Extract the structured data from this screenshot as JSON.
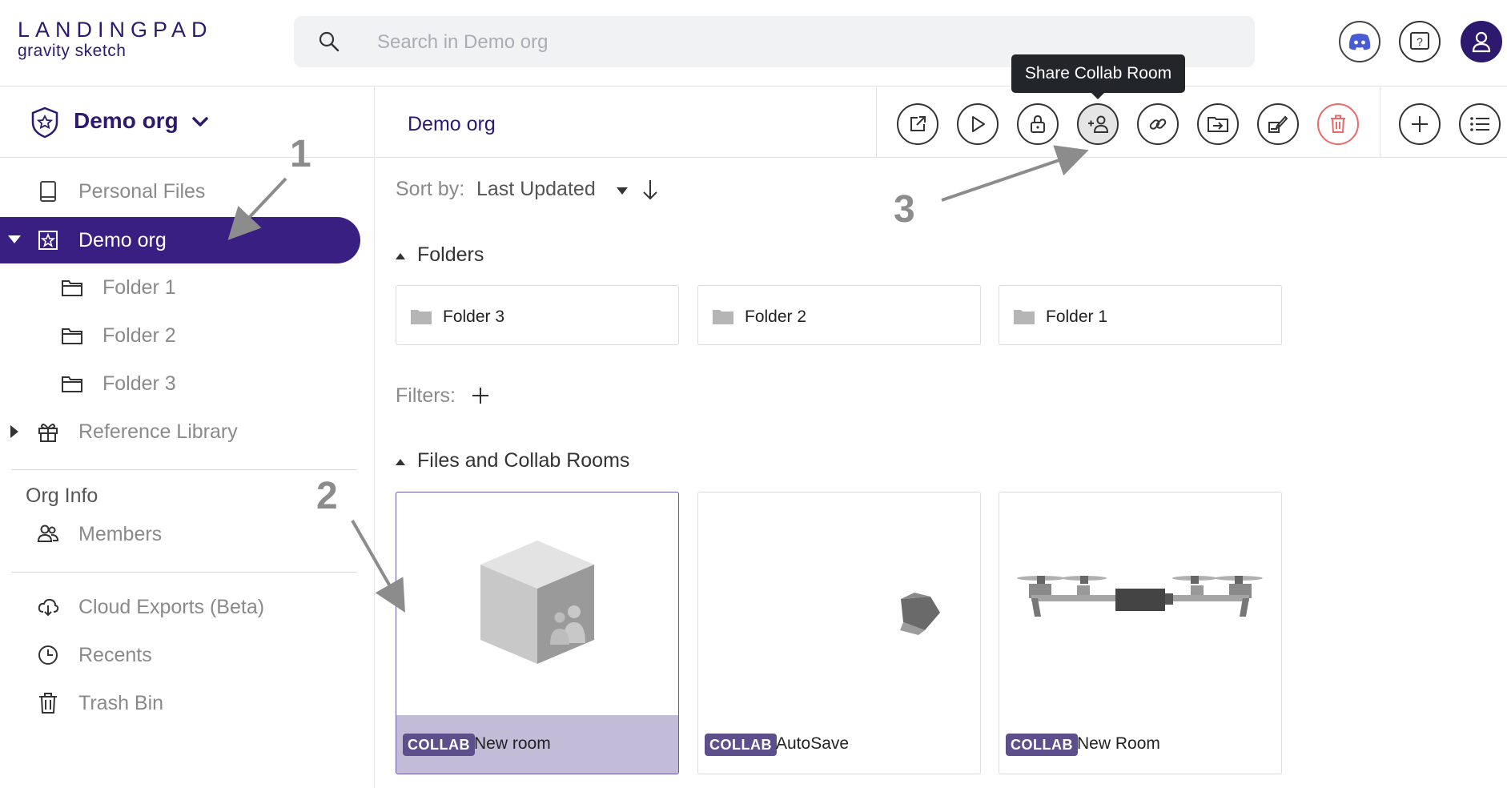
{
  "header": {
    "logo_top": "LANDINGPAD",
    "logo_bottom": "gravity sketch",
    "search_placeholder": "Search in Demo org"
  },
  "sidebar": {
    "org_name": "Demo org",
    "items": [
      {
        "label": "Personal Files",
        "icon": "tablet-icon"
      },
      {
        "label": "Demo org",
        "icon": "org-star-icon",
        "active": true
      },
      {
        "label": "Folder 1",
        "icon": "folder-icon"
      },
      {
        "label": "Folder 2",
        "icon": "folder-icon"
      },
      {
        "label": "Folder 3",
        "icon": "folder-icon"
      },
      {
        "label": "Reference Library",
        "icon": "gift-icon"
      }
    ],
    "org_info_title": "Org Info",
    "members_label": "Members",
    "bottom_items": [
      {
        "label": "Cloud Exports (Beta)",
        "icon": "cloud-download-icon"
      },
      {
        "label": "Recents",
        "icon": "clock-icon"
      },
      {
        "label": "Trash Bin",
        "icon": "trash-icon"
      }
    ]
  },
  "toolbar": {
    "breadcrumb": "Demo org",
    "tooltip": "Share Collab Room",
    "danger_color": "#e86a6a"
  },
  "content": {
    "sort_label": "Sort by:",
    "sort_value": "Last Updated",
    "folders_title": "Folders",
    "folders": [
      "Folder 3",
      "Folder 2",
      "Folder 1"
    ],
    "filters_label": "Filters:",
    "files_title": "Files and Collab Rooms",
    "files": [
      {
        "badge": "COLLAB",
        "name": "New room",
        "selected": true
      },
      {
        "badge": "COLLAB",
        "name": "AutoSave"
      },
      {
        "badge": "COLLAB",
        "name": "New Room"
      }
    ]
  },
  "annotations": [
    "1",
    "2",
    "3"
  ],
  "colors": {
    "brand": "#2d1a6e",
    "active_nav": "#3a1f82",
    "badge": "#5d4f8c",
    "selected_footer": "#c3bcd8"
  }
}
